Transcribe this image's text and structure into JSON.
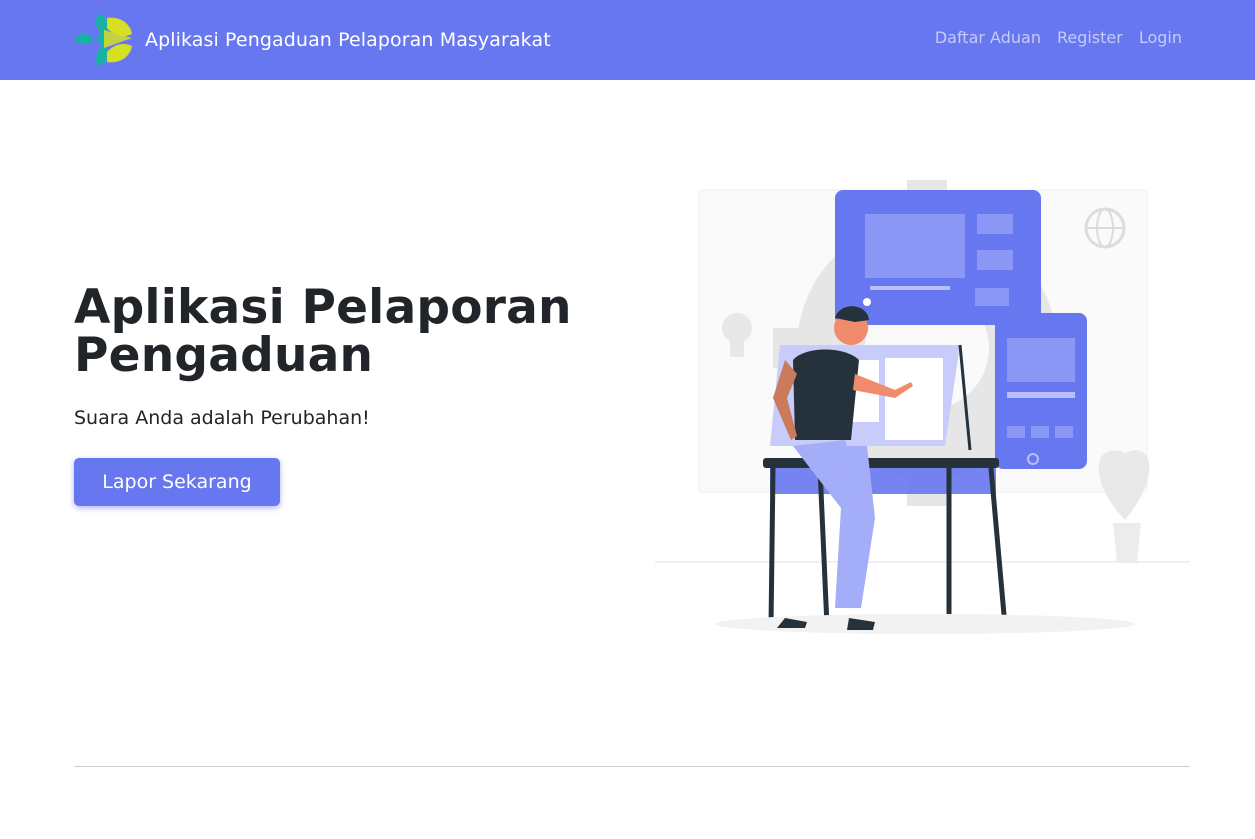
{
  "navbar": {
    "brand_text": "Aplikasi Pengaduan Pelaporan Masyarakat",
    "links": [
      {
        "label": "Daftar Aduan"
      },
      {
        "label": "Register"
      },
      {
        "label": "Login"
      }
    ]
  },
  "hero": {
    "title": "Aplikasi Pelaporan Pengaduan",
    "subtitle": "Suara Anda adalah Perubahan!",
    "cta_label": "Lapor Sekarang"
  },
  "colors": {
    "accent": "#6777ef",
    "text": "#212529",
    "logo_teal": "#1bb0a6",
    "logo_yellow": "#d7df23"
  },
  "icons": {
    "brand": "kemenkes-logo-icon"
  }
}
